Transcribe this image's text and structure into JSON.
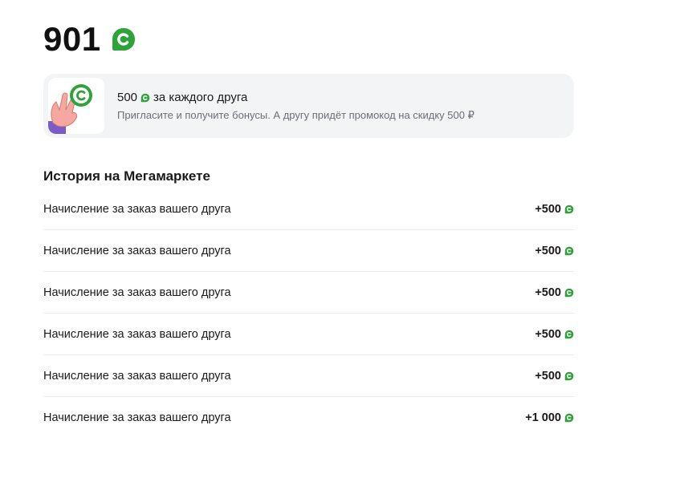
{
  "balance": {
    "value": "901",
    "icon": "bonus-coin-icon"
  },
  "promo": {
    "amount": "500",
    "title_suffix": "за каждого друга",
    "subtitle": "Пригласите и получите бонусы. А другу придёт промокод на скидку 500 ₽",
    "image": "hand-with-coin-icon"
  },
  "history": {
    "title": "История на Мегамаркете",
    "items": [
      {
        "label": "Начисление за заказ вашего друга",
        "amount": "+500"
      },
      {
        "label": "Начисление за заказ вашего друга",
        "amount": "+500"
      },
      {
        "label": "Начисление за заказ вашего друга",
        "amount": "+500"
      },
      {
        "label": "Начисление за заказ вашего друга",
        "amount": "+500"
      },
      {
        "label": "Начисление за заказ вашего друга",
        "amount": "+500"
      },
      {
        "label": "Начисление за заказ вашего друга",
        "amount": "+1 000"
      }
    ]
  },
  "colors": {
    "accent_green": "#2ea33a",
    "card_bg": "#f3f4f6",
    "text_primary": "#1a1a1a",
    "text_secondary": "#6b6f76"
  }
}
